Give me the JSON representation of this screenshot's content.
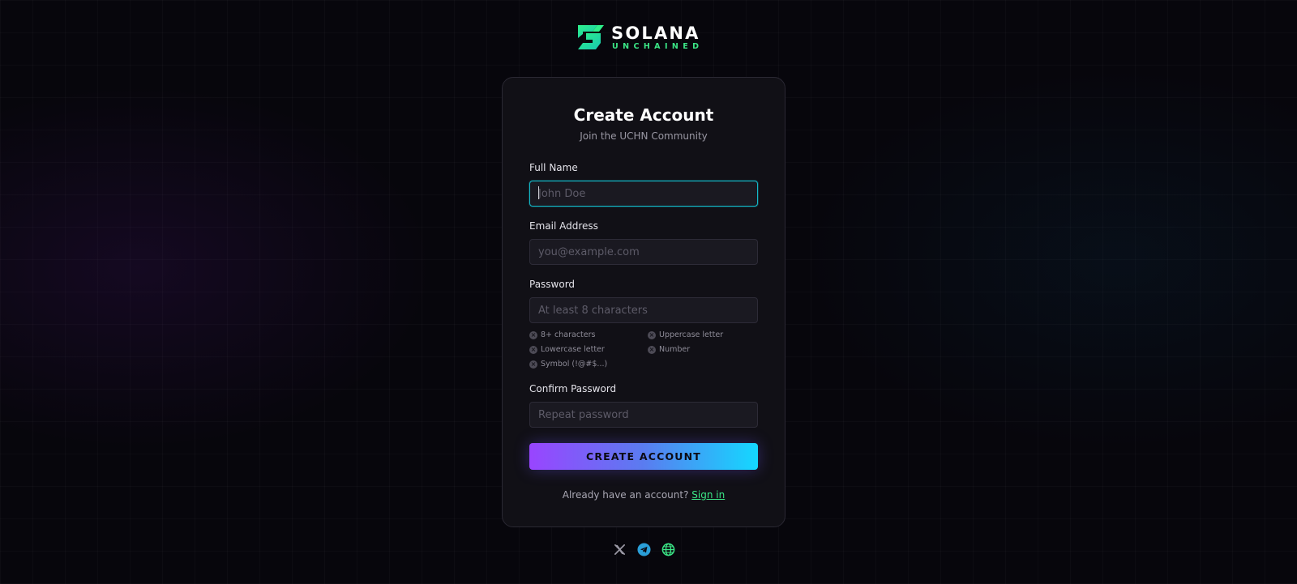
{
  "brand": {
    "title": "SOLANA",
    "subtitle": "UNCHAINED",
    "icon": "solana-s-logo-icon",
    "colors": {
      "accent_green": "#3be586",
      "mark_green": "#2ef08a",
      "mark_teal": "#18c8b0"
    }
  },
  "form": {
    "title": "Create Account",
    "subtitle": "Join the UCHN Community",
    "fields": [
      {
        "label": "Full Name",
        "placeholder": "John Doe",
        "value": "",
        "focused": true
      },
      {
        "label": "Email Address",
        "placeholder": "you@example.com",
        "value": ""
      },
      {
        "label": "Password",
        "placeholder": "At least 8 characters",
        "value": ""
      },
      {
        "label": "Confirm Password",
        "placeholder": "Repeat password",
        "value": ""
      }
    ],
    "requirements": [
      {
        "label": "8+ characters",
        "met": false
      },
      {
        "label": "Uppercase letter",
        "met": false
      },
      {
        "label": "Lowercase letter",
        "met": false
      },
      {
        "label": "Number",
        "met": false
      },
      {
        "label": "Symbol (!@#$...)",
        "met": false
      }
    ],
    "submit_label": "CREATE ACCOUNT",
    "signin_prompt": "Already have an account?",
    "signin_link": "Sign in"
  },
  "social": [
    {
      "name": "x-icon",
      "color": "#9a98a4"
    },
    {
      "name": "telegram-icon",
      "color": "#2a9fd8"
    },
    {
      "name": "globe-icon",
      "color": "#3be586"
    }
  ],
  "colors": {
    "background": "#07060c",
    "card": "#111016",
    "input": "#1a1921",
    "focus_border": "#14b8c8",
    "button_gradient": [
      "#9945ff",
      "#14d8ff"
    ]
  }
}
